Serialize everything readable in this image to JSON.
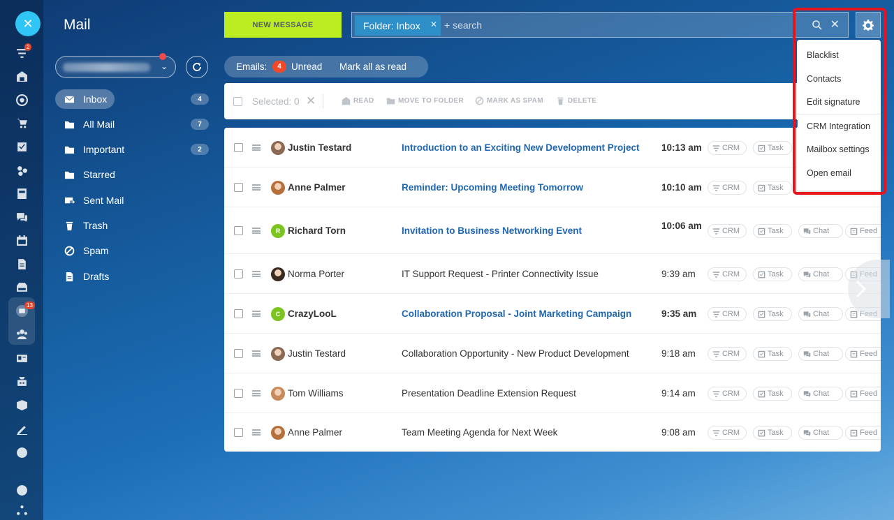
{
  "rail": {
    "badges": {
      "filter": "2",
      "mail": "13"
    }
  },
  "sidebar": {
    "title": "Mail",
    "folders": [
      {
        "label": "Inbox",
        "count": "4",
        "icon": "mail-icon"
      },
      {
        "label": "All Mail",
        "count": "7",
        "icon": "folder-icon"
      },
      {
        "label": "Important",
        "count": "2",
        "icon": "folder-icon"
      },
      {
        "label": "Starred",
        "count": "",
        "icon": "folder-icon"
      },
      {
        "label": "Sent Mail",
        "count": "",
        "icon": "sent-mail-icon"
      },
      {
        "label": "Trash",
        "count": "",
        "icon": "trash-icon"
      },
      {
        "label": "Spam",
        "count": "",
        "icon": "spam-icon"
      },
      {
        "label": "Drafts",
        "count": "",
        "icon": "drafts-icon"
      }
    ]
  },
  "topbar": {
    "new_message": "NEW MESSAGE",
    "folder_chip": "Folder: Inbox",
    "search_placeholder": "+ search"
  },
  "emails_bar": {
    "label": "Emails:",
    "unread_count": "4",
    "unread_label": "Unread",
    "mark_all": "Mark all as read"
  },
  "toolbar": {
    "selected": "Selected: 0",
    "read": "READ",
    "move": "MOVE TO FOLDER",
    "spam": "MARK AS SPAM",
    "delete": "DELETE"
  },
  "menu": {
    "items": [
      "Blacklist",
      "Contacts",
      "Edit signature",
      "CRM Integration",
      "Mailbox settings",
      "Open email"
    ]
  },
  "actions": {
    "crm": "CRM",
    "task": "Task",
    "chat": "Chat",
    "feed": "Feed"
  },
  "emails": [
    {
      "sender": "Justin Testard",
      "subject": "Introduction to an Exciting New Development Project",
      "time": "10:13 am",
      "unread": true,
      "avatar": "photo",
      "avatar_color": "#8a6a55"
    },
    {
      "sender": "Anne Palmer",
      "subject": "Reminder: Upcoming Meeting Tomorrow",
      "time": "10:10 am",
      "unread": true,
      "avatar": "photo",
      "avatar_color": "#b5703c"
    },
    {
      "sender": "Richard Torn",
      "subject": "Invitation to Business Networking Event",
      "time": "10:06 am",
      "unread": true,
      "avatar": "R",
      "avatar_color": "#7cc520"
    },
    {
      "sender": "Norma Porter",
      "subject": "IT Support Request - Printer Connectivity Issue",
      "time": "9:39 am",
      "unread": false,
      "avatar": "photo",
      "avatar_color": "#3a2a22"
    },
    {
      "sender": "CrazyLooL",
      "subject": "Collaboration Proposal - Joint Marketing Campaign",
      "time": "9:35 am",
      "unread": true,
      "avatar": "C",
      "avatar_color": "#7cc520"
    },
    {
      "sender": "Justin Testard",
      "subject": "Collaboration Opportunity - New Product Development",
      "time": "9:18 am",
      "unread": false,
      "avatar": "photo",
      "avatar_color": "#8a6a55"
    },
    {
      "sender": "Tom Williams",
      "subject": "Presentation Deadline Extension Request",
      "time": "9:14 am",
      "unread": false,
      "avatar": "photo",
      "avatar_color": "#c88a5a"
    },
    {
      "sender": "Anne Palmer",
      "subject": "Team Meeting Agenda for Next Week",
      "time": "9:08 am",
      "unread": false,
      "avatar": "photo",
      "avatar_color": "#b5703c"
    }
  ]
}
